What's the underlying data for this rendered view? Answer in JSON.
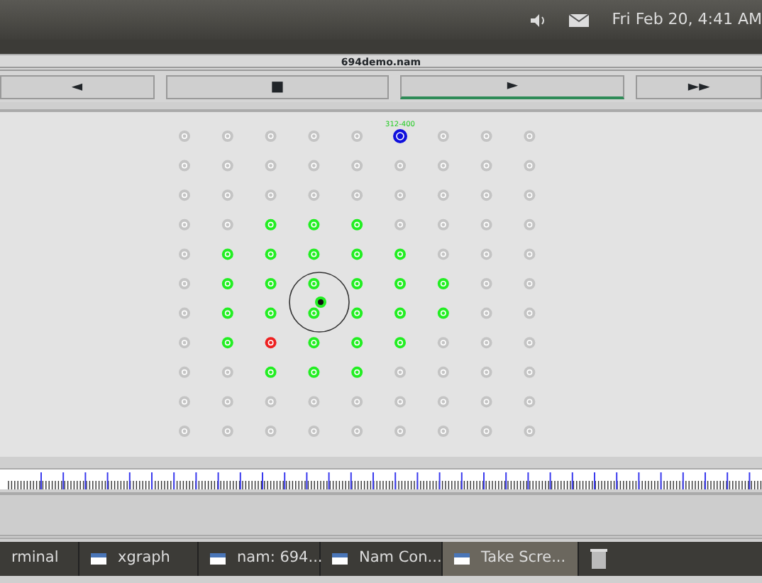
{
  "top_panel": {
    "clock": "Fri Feb 20,  4:41 AM"
  },
  "window": {
    "title": "694demo.nam"
  },
  "controls": [
    {
      "label": "◄",
      "selected": false
    },
    {
      "label": "■",
      "selected": false
    },
    {
      "label": "►",
      "selected": true
    },
    {
      "label": "►►",
      "selected": false
    }
  ],
  "network": {
    "grid": [
      [
        {
          "color": "#c4c4c4"
        },
        {
          "color": "#c4c4c4"
        },
        {
          "color": "#c4c4c4"
        },
        {
          "color": "#c4c4c4"
        },
        {
          "color": "#c4c4c4"
        },
        {
          "color": "#1010dd",
          "label": "312-400"
        },
        {
          "color": "#c4c4c4"
        },
        {
          "color": "#c4c4c4"
        },
        {
          "color": "#c4c4c4"
        }
      ],
      [
        {
          "color": "#c4c4c4"
        },
        {
          "color": "#c4c4c4"
        },
        {
          "color": "#c4c4c4"
        },
        {
          "color": "#c4c4c4"
        },
        {
          "color": "#c4c4c4"
        },
        {
          "color": "#c4c4c4"
        },
        {
          "color": "#c4c4c4"
        },
        {
          "color": "#c4c4c4"
        },
        {
          "color": "#c4c4c4"
        }
      ],
      [
        {
          "color": "#c4c4c4"
        },
        {
          "color": "#c4c4c4"
        },
        {
          "color": "#c4c4c4"
        },
        {
          "color": "#c4c4c4"
        },
        {
          "color": "#c4c4c4"
        },
        {
          "color": "#c4c4c4"
        },
        {
          "color": "#c4c4c4"
        },
        {
          "color": "#c4c4c4"
        },
        {
          "color": "#c4c4c4"
        }
      ],
      [
        {
          "color": "#c4c4c4"
        },
        {
          "color": "#c4c4c4"
        },
        {
          "color": "#22ee22"
        },
        {
          "color": "#22ee22"
        },
        {
          "color": "#22ee22"
        },
        {
          "color": "#c4c4c4"
        },
        {
          "color": "#c4c4c4"
        },
        {
          "color": "#c4c4c4"
        },
        {
          "color": "#c4c4c4"
        }
      ],
      [
        {
          "color": "#c4c4c4"
        },
        {
          "color": "#22ee22"
        },
        {
          "color": "#22ee22"
        },
        {
          "color": "#22ee22"
        },
        {
          "color": "#22ee22"
        },
        {
          "color": "#22ee22"
        },
        {
          "color": "#c4c4c4"
        },
        {
          "color": "#c4c4c4"
        },
        {
          "color": "#c4c4c4"
        }
      ],
      [
        {
          "color": "#c4c4c4"
        },
        {
          "color": "#22ee22"
        },
        {
          "color": "#22ee22"
        },
        {
          "color": "#22ee22"
        },
        {
          "color": "#22ee22"
        },
        {
          "color": "#22ee22"
        },
        {
          "color": "#22ee22"
        },
        {
          "color": "#c4c4c4"
        },
        {
          "color": "#c4c4c4"
        }
      ],
      [
        {
          "color": "#c4c4c4"
        },
        {
          "color": "#22ee22"
        },
        {
          "color": "#22ee22"
        },
        {
          "color": "#22ee22"
        },
        {
          "color": "#22ee22"
        },
        {
          "color": "#22ee22"
        },
        {
          "color": "#22ee22"
        },
        {
          "color": "#c4c4c4"
        },
        {
          "color": "#c4c4c4"
        }
      ],
      [
        {
          "color": "#c4c4c4"
        },
        {
          "color": "#22ee22"
        },
        {
          "color": "#ee2020"
        },
        {
          "color": "#22ee22"
        },
        {
          "color": "#22ee22"
        },
        {
          "color": "#22ee22"
        },
        {
          "color": "#c4c4c4"
        },
        {
          "color": "#c4c4c4"
        },
        {
          "color": "#c4c4c4"
        }
      ],
      [
        {
          "color": "#c4c4c4"
        },
        {
          "color": "#c4c4c4"
        },
        {
          "color": "#22ee22"
        },
        {
          "color": "#22ee22"
        },
        {
          "color": "#22ee22"
        },
        {
          "color": "#c4c4c4"
        },
        {
          "color": "#c4c4c4"
        },
        {
          "color": "#c4c4c4"
        },
        {
          "color": "#c4c4c4"
        }
      ],
      [
        {
          "color": "#c4c4c4"
        },
        {
          "color": "#c4c4c4"
        },
        {
          "color": "#c4c4c4"
        },
        {
          "color": "#c4c4c4"
        },
        {
          "color": "#c4c4c4"
        },
        {
          "color": "#c4c4c4"
        },
        {
          "color": "#c4c4c4"
        },
        {
          "color": "#c4c4c4"
        },
        {
          "color": "#c4c4c4"
        }
      ],
      [
        {
          "color": "#c4c4c4"
        },
        {
          "color": "#c4c4c4"
        },
        {
          "color": "#c4c4c4"
        },
        {
          "color": "#c4c4c4"
        },
        {
          "color": "#c4c4c4"
        },
        {
          "color": "#c4c4c4"
        },
        {
          "color": "#c4c4c4"
        },
        {
          "color": "#c4c4c4"
        },
        {
          "color": "#c4c4c4"
        }
      ]
    ]
  },
  "taskbar": [
    {
      "label": "rminal",
      "selected": false,
      "icon": false
    },
    {
      "label": "xgraph",
      "selected": false,
      "icon": true
    },
    {
      "label": "nam: 694...",
      "selected": false,
      "icon": true
    },
    {
      "label": "Nam Con...",
      "selected": false,
      "icon": true
    },
    {
      "label": "Take Scre...",
      "selected": true,
      "icon": true
    }
  ]
}
